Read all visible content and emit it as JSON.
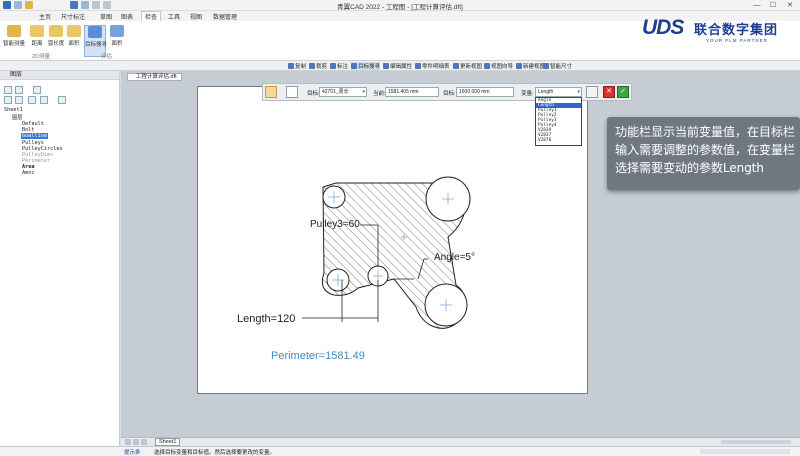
{
  "app": {
    "title": "青翼CAD 2022 - 工程图 - [工程计算评估.dft]",
    "window_controls": [
      "—",
      "☐",
      "✕"
    ]
  },
  "tabs": [
    "主页",
    "尺寸标注",
    "草图",
    "图表",
    "检查",
    "工具",
    "视图",
    "数据管理"
  ],
  "active_tab": "检查",
  "ribbon": {
    "buttons": [
      "智能测量",
      "距离",
      "弧长度",
      "面积",
      "目标搜寻",
      "面积"
    ],
    "groups": [
      "2D测量",
      "评估"
    ]
  },
  "logo": {
    "brand": "UDS",
    "name_cn": "联合数字集团",
    "tagline": "YOUR PLM PARTNER"
  },
  "toolbar2": [
    "复制",
    "裁剪",
    "标注",
    "目标搜寻",
    "编辑属性",
    "零件明细表",
    "更新视图",
    "视图向导",
    "新建视图",
    "智能尺寸"
  ],
  "left_panel": {
    "title": "图层",
    "tree": [
      {
        "label": "Sheet1",
        "style": "normal"
      },
      {
        "label": "图层",
        "style": "normal"
      },
      {
        "label": "Default",
        "style": "normal"
      },
      {
        "label": "Bolt",
        "style": "normal"
      },
      {
        "label": "Goalline",
        "style": "selected"
      },
      {
        "label": "Pulleys",
        "style": "normal"
      },
      {
        "label": "PulleyCircles",
        "style": "normal"
      },
      {
        "label": "PulleyDims",
        "style": "dim"
      },
      {
        "label": "Perimeter",
        "style": "dim"
      },
      {
        "label": "Area",
        "style": "bold"
      },
      {
        "label": "Amnc",
        "style": "normal"
      }
    ]
  },
  "document_tab": "工程计算评估.dft",
  "param_bar": {
    "goal_label": "目标:",
    "goal_value": "42701_周长",
    "current_label": "当前:",
    "current_value": "1581.405 mm",
    "target_label": "目标:",
    "target_value": "1600.000 mm",
    "variable_label": "变量:",
    "variable_value": "Length"
  },
  "dropdown_options": [
    "Angle",
    "Length",
    "Pulley1",
    "Pulley2",
    "Pulley3",
    "Pulley4",
    "V2839",
    "V2837",
    "V2870"
  ],
  "dropdown_highlight": "Length",
  "drawing": {
    "labels": {
      "pulley3": "Pulley3=60",
      "angle": "Angle=5°",
      "length": "Length=120",
      "perimeter": "Perimeter=1581.49"
    }
  },
  "callout": {
    "text": "功能栏显示当前变量值，在目标栏输入需要调整的参数值，在变量栏选择需要变动的参数Length"
  },
  "bottom": {
    "sheet_tab": "Sheet1"
  },
  "status": {
    "tab_label": "提示条",
    "message": "选择目标变量和目标值。然后选择要更改的变量。"
  },
  "colors": {
    "accent": "#1e3f8f",
    "selection": "#3d7ad6",
    "perimeter_text": "#4a8ab8",
    "callout_bg": "#6f7880"
  }
}
